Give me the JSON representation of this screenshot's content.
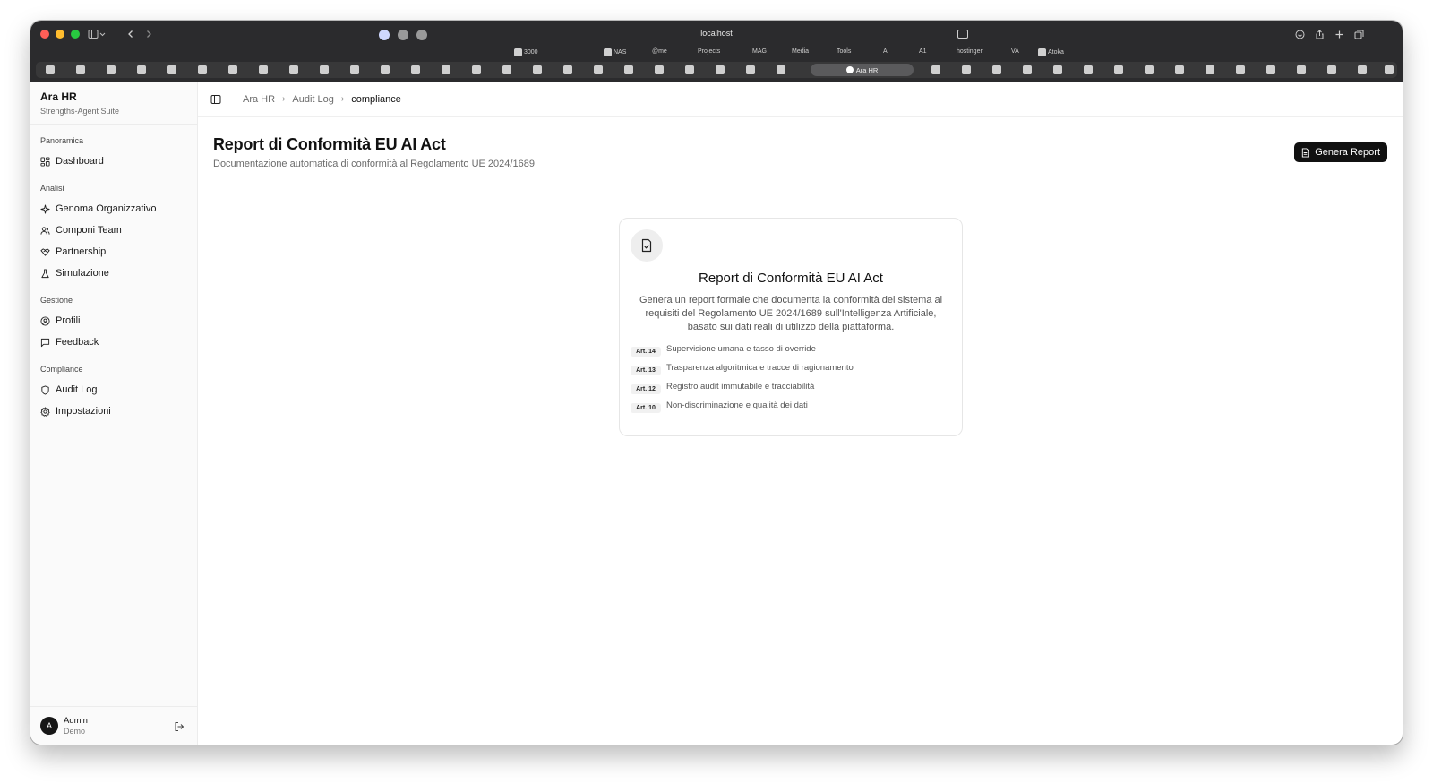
{
  "browser": {
    "url": "localhost",
    "bookmarks": [
      "3000",
      "NAS",
      "@me",
      "Projects",
      "MAG",
      "Media",
      "Tools",
      "AI",
      "A1",
      "hostinger",
      "VA",
      "Atoka"
    ],
    "active_tab": "Ara HR"
  },
  "sidebar": {
    "brand": "Ara HR",
    "brand_sub": "Strengths-Agent Suite",
    "groups": [
      {
        "label": "Panoramica",
        "items": [
          {
            "label": "Dashboard",
            "icon": "grid-icon"
          }
        ]
      },
      {
        "label": "Analisi",
        "items": [
          {
            "label": "Genoma Organizzativo",
            "icon": "sparkle-icon"
          },
          {
            "label": "Componi Team",
            "icon": "users-icon"
          },
          {
            "label": "Partnership",
            "icon": "handshake-icon"
          },
          {
            "label": "Simulazione",
            "icon": "flask-icon"
          }
        ]
      },
      {
        "label": "Gestione",
        "items": [
          {
            "label": "Profili",
            "icon": "user-circle-icon"
          },
          {
            "label": "Feedback",
            "icon": "message-icon"
          }
        ]
      },
      {
        "label": "Compliance",
        "items": [
          {
            "label": "Audit Log",
            "icon": "shield-icon"
          },
          {
            "label": "Impostazioni",
            "icon": "gear-icon"
          }
        ]
      }
    ],
    "user": {
      "initial": "A",
      "name": "Admin",
      "role": "Demo"
    }
  },
  "breadcrumb": [
    "Ara HR",
    "Audit Log",
    "compliance"
  ],
  "page": {
    "title": "Report di Conformità EU AI Act",
    "subtitle": "Documentazione automatica di conformità al Regolamento UE 2024/1689",
    "generate_button": "Genera Report"
  },
  "card": {
    "title": "Report di Conformità EU AI Act",
    "description": "Genera un report formale che documenta la conformità del sistema ai requisiti del Regolamento UE 2024/1689 sull'Intelligenza Artificiale, basato sui dati reali di utilizzo della piattaforma.",
    "articles": [
      {
        "badge": "Art. 14",
        "text": "Supervisione umana e tasso di override"
      },
      {
        "badge": "Art. 13",
        "text": "Trasparenza algoritmica e tracce di ragionamento"
      },
      {
        "badge": "Art. 12",
        "text": "Registro audit immutabile e tracciabilità"
      },
      {
        "badge": "Art. 10",
        "text": "Non-discriminazione e qualità dei dati"
      }
    ]
  },
  "colors": {
    "primary_button": "#111111",
    "chrome": "#2b2b2d"
  }
}
